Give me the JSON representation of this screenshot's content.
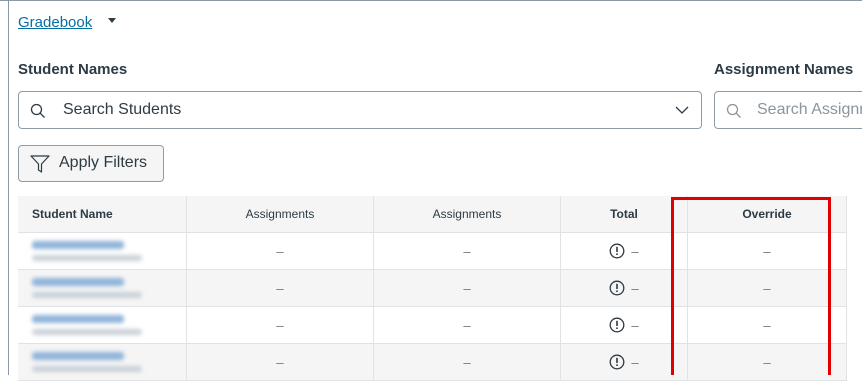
{
  "header": {
    "gradebook_label": "Gradebook"
  },
  "student_filter": {
    "label": "Student Names",
    "placeholder": "Search Students"
  },
  "assignment_filter": {
    "label": "Assignment Names",
    "placeholder": "Search Assignm"
  },
  "apply_filters_label": "Apply Filters",
  "table": {
    "headers": [
      "Student Name",
      "Assignments",
      "Assignments",
      "Total",
      "Override"
    ],
    "rows": [
      {
        "assignments1": "–",
        "assignments2": "–",
        "total": "–",
        "override": "–"
      },
      {
        "assignments1": "–",
        "assignments2": "–",
        "total": "–",
        "override": "–"
      },
      {
        "assignments1": "–",
        "assignments2": "–",
        "total": "–",
        "override": "–"
      },
      {
        "assignments1": "–",
        "assignments2": "–",
        "total": "–",
        "override": "–"
      }
    ]
  },
  "colors": {
    "link": "#0770a3",
    "highlight": "#e00000",
    "header_bg": "#f5f5f5"
  },
  "icons": {
    "search": "search-icon",
    "chevron": "chevron-down-icon",
    "filter": "filter-icon",
    "warning": "warning-icon"
  }
}
